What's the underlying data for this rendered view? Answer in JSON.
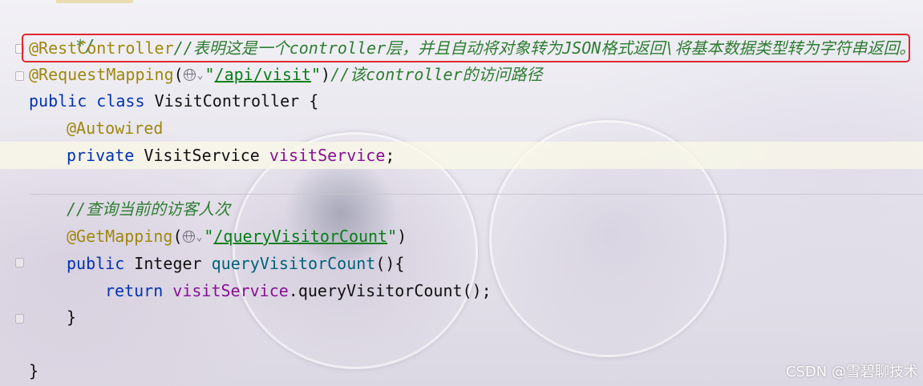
{
  "colors": {
    "annotation": "#9e880d",
    "comment": "#2e7d32",
    "keyword": "#0033b3",
    "field": "#871094",
    "string": "#067d17",
    "method_call": "#00627a",
    "highlight_box": "#e0282e"
  },
  "code": {
    "line_comment_end": "*/",
    "line_restcontroller": {
      "annotation": "@RestController",
      "comment": "//表明这是一个controller层，并且自动将对象转为JSON格式返回\\将基本数据类型转为字符串返回。"
    },
    "line_requestmapping": {
      "annotation": "@RequestMapping",
      "open": "(",
      "globe_icon": "globe-icon",
      "chevron": "⌄",
      "quote_open": "\"",
      "path": "/api/visit",
      "quote_close": "\"",
      "close": ")",
      "comment": "//该controller的访问路径"
    },
    "line_class": {
      "kw_public": "public",
      "kw_class": "class",
      "name": "VisitController",
      "brace": "{"
    },
    "line_autowired": "@Autowired",
    "line_field": {
      "kw_private": "private",
      "type": "VisitService",
      "name": "visitService",
      "semicolon": ";"
    },
    "line_query_comment": "//查询当前的访客人次",
    "line_getmapping": {
      "annotation": "@GetMapping",
      "open": "(",
      "chevron": "⌄",
      "quote_open": "\"",
      "path": "/queryVisitorCount",
      "quote_close": "\"",
      "close": ")"
    },
    "line_method": {
      "kw_public": "public",
      "type": "Integer",
      "name": "queryVisitorCount",
      "parens": "(){"
    },
    "line_return": {
      "kw_return": "return",
      "field": "visitService",
      "call": ".queryVisitorCount();"
    },
    "line_method_close": "}",
    "line_class_close": "}"
  },
  "watermark": "CSDN @雪碧聊技术"
}
